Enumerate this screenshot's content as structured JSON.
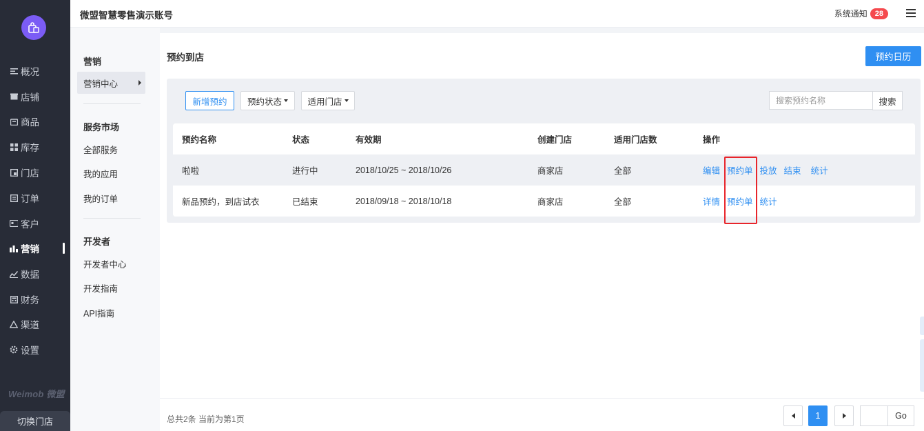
{
  "sidebar": {
    "items": [
      {
        "label": "概况",
        "icon": "align-left-icon"
      },
      {
        "label": "店铺",
        "icon": "shop-icon"
      },
      {
        "label": "商品",
        "icon": "bag-icon"
      },
      {
        "label": "库存",
        "icon": "grid-icon"
      },
      {
        "label": "门店",
        "icon": "store-icon"
      },
      {
        "label": "订单",
        "icon": "list-icon"
      },
      {
        "label": "客户",
        "icon": "card-icon"
      },
      {
        "label": "营销",
        "icon": "bar-chart-icon",
        "active": true
      },
      {
        "label": "数据",
        "icon": "line-chart-icon"
      },
      {
        "label": "财务",
        "icon": "calculator-icon"
      },
      {
        "label": "渠道",
        "icon": "recycle-icon"
      },
      {
        "label": "设置",
        "icon": "gear-icon"
      }
    ],
    "brand": "Weimob 微盟",
    "switch_store": "切换门店"
  },
  "topbar": {
    "account": "微盟智慧零售演示账号",
    "notice_label": "系统通知",
    "notice_count": "28"
  },
  "subnav": {
    "groups": [
      {
        "title": "营销",
        "items": [
          "营销中心"
        ]
      },
      {
        "title": "服务市场",
        "items": [
          "全部服务",
          "我的应用",
          "我的订单"
        ]
      },
      {
        "title": "开发者",
        "items": [
          "开发者中心",
          "开发指南",
          "API指南"
        ]
      }
    ],
    "active_item": "营销中心"
  },
  "main": {
    "title": "预约到店",
    "calendar_button": "预约日历",
    "toolbar": {
      "new_button": "新增预约",
      "status_dropdown": "预约状态",
      "store_dropdown": "适用门店",
      "search_placeholder": "搜索预约名称",
      "search_button": "搜索"
    },
    "table": {
      "headers": [
        "预约名称",
        "状态",
        "有效期",
        "创建门店",
        "适用门店数",
        "操作"
      ],
      "rows": [
        {
          "name": "啦啦",
          "status": "进行中",
          "period": "2018/10/25 ~ 2018/10/26",
          "store": "商家店",
          "store_count": "全部",
          "ops": [
            "编辑",
            "预约单",
            "投放",
            "结束",
            "统计"
          ]
        },
        {
          "name": "新品预约，到店试衣",
          "status": "已结束",
          "period": "2018/09/18 ~ 2018/10/18",
          "store": "商家店",
          "store_count": "全部",
          "ops": [
            "详情",
            "预约单",
            "统计"
          ]
        }
      ]
    }
  },
  "footer": {
    "summary": "总共2条 当前为第1页",
    "current_page": "1",
    "go_button": "Go"
  },
  "colors": {
    "accent": "#2f8ff2",
    "sidebar_bg": "#282c37",
    "badge": "#f5494e",
    "highlight": "#e8252b"
  }
}
